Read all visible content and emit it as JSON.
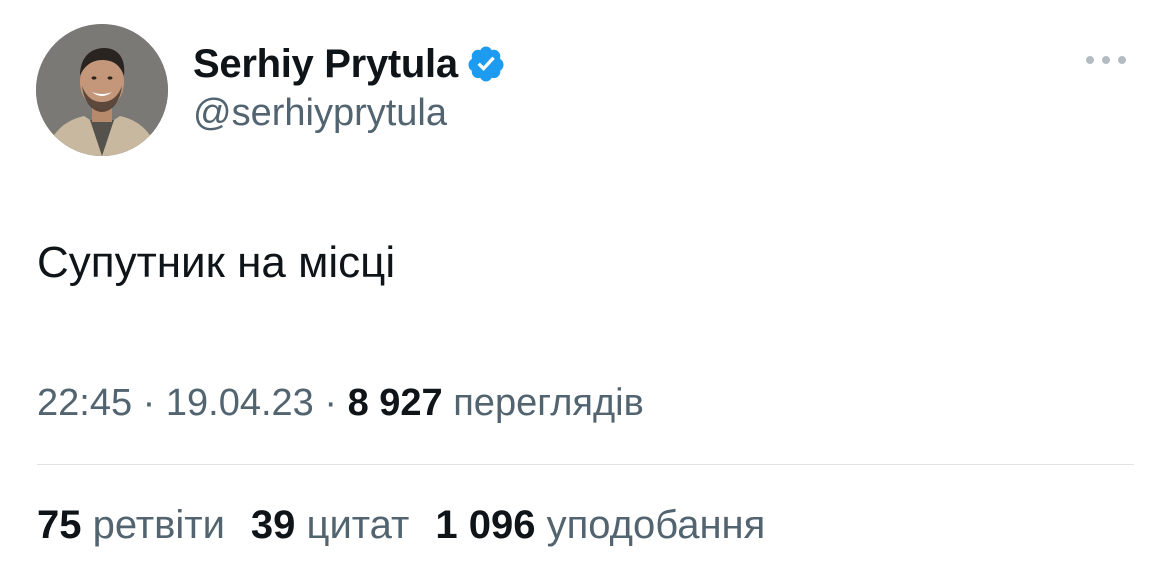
{
  "author": {
    "display_name": "Serhiy Prytula",
    "handle": "@serhiyprytula",
    "verified": true,
    "avatar_icon": "profile-photo"
  },
  "tweet": {
    "text": "Супутник на місці"
  },
  "meta": {
    "time": "22:45",
    "separator": " · ",
    "date": "19.04.23",
    "views_count": "8 927",
    "views_label": "переглядів"
  },
  "stats": {
    "retweets_count": "75",
    "retweets_label": "ретвіти",
    "quotes_count": "39",
    "quotes_label": "цитат",
    "likes_count": "1 096",
    "likes_label": "уподобання"
  },
  "colors": {
    "text_primary": "#0f1419",
    "text_secondary": "#536471",
    "verified_blue": "#1d9bf0",
    "divider": "#dfe3e6"
  },
  "icons": {
    "verified": "verified-badge-icon",
    "more": "more-dots-icon"
  }
}
